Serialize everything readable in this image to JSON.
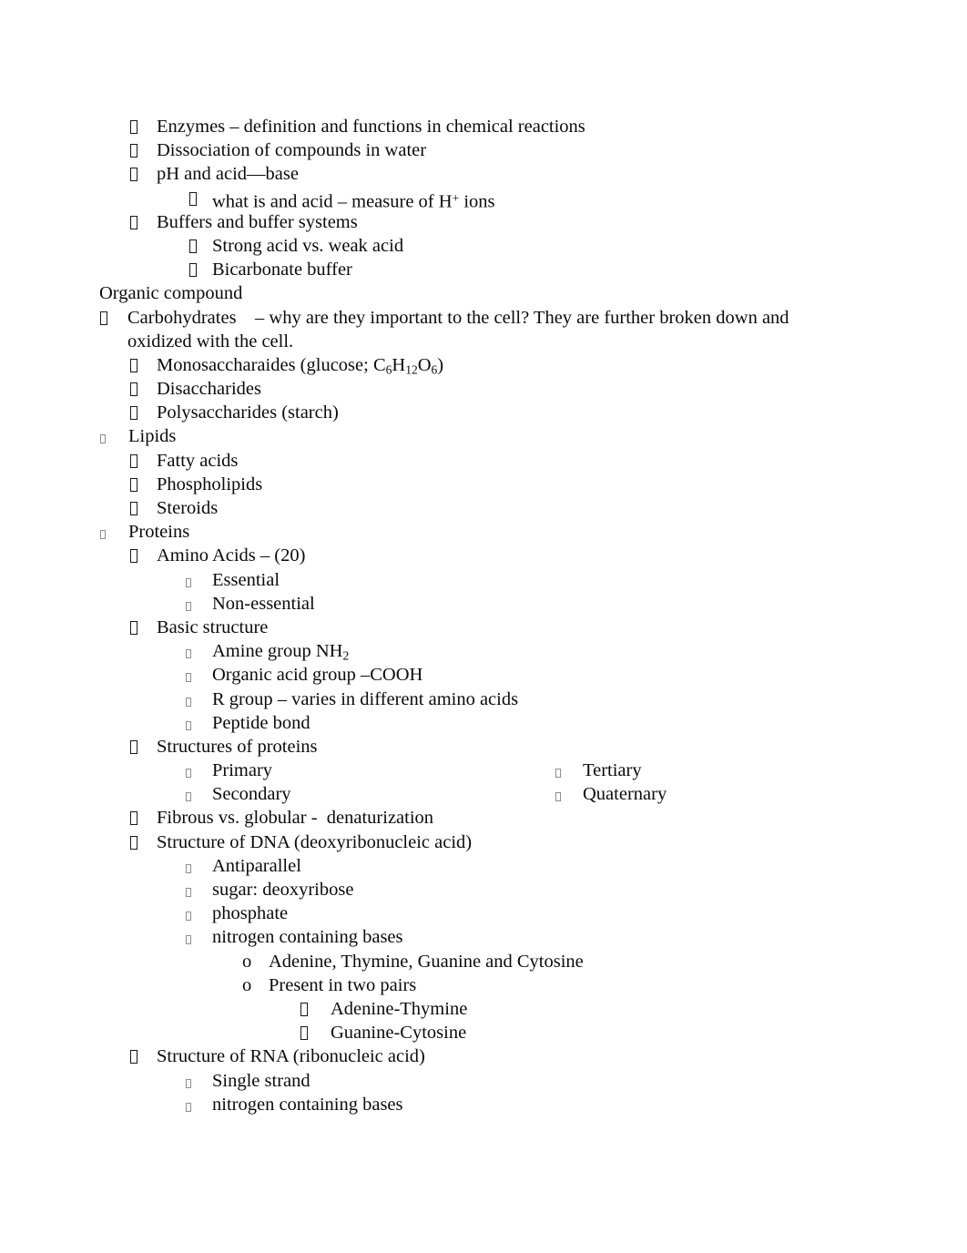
{
  "document": {
    "title": "Organic Compounds Study Outline",
    "background_color": "#ffffff",
    "text_color": "#0b0b0b",
    "bullet_glyph": "missing-glyph-box"
  },
  "outline": {
    "section_heading": "Organic compound",
    "items": [
      {
        "id": "enzymes",
        "level": 1,
        "text": "Enzymes – definition and functions in chemical reactions"
      },
      {
        "id": "dissociation",
        "level": 1,
        "text": "Dissociation of compounds in water"
      },
      {
        "id": "ph-acid-base",
        "level": 1,
        "text": "pH and acid—base"
      },
      {
        "id": "what-is-acid",
        "level": 2,
        "text_pre": "what is and acid – measure of H",
        "sup": "+",
        "text_post": " ions"
      },
      {
        "id": "buffers",
        "level": 1,
        "text": "Buffers and buffer systems"
      },
      {
        "id": "strong-weak-acid",
        "level": 2,
        "text": "Strong acid vs. weak acid"
      },
      {
        "id": "bicarbonate-buffer",
        "level": 2,
        "text": "Bicarbonate buffer"
      },
      {
        "id": "carbohydrates",
        "level": 1,
        "text": "Carbohydrates    – why are they important to the cell? They are further broken down and oxidized with the cell."
      },
      {
        "id": "monosaccharaides",
        "level": 2,
        "text_pre": "Monosaccharaides (glucose; C",
        "sub1": "6",
        "mid1": "H",
        "sub2": "12",
        "mid2": "O",
        "sub3": "6",
        "text_post": ")"
      },
      {
        "id": "disaccharides",
        "level": 2,
        "text": "Disaccharides"
      },
      {
        "id": "polysaccharides",
        "level": 2,
        "text": "Polysaccharides (starch)"
      },
      {
        "id": "lipids",
        "level": 1,
        "text": "Lipids"
      },
      {
        "id": "fatty-acids",
        "level": 2,
        "text": "Fatty acids"
      },
      {
        "id": "phospholipids",
        "level": 2,
        "text": "Phospholipids"
      },
      {
        "id": "steroids",
        "level": 2,
        "text": "Steroids"
      },
      {
        "id": "proteins",
        "level": 1,
        "text": "Proteins"
      },
      {
        "id": "amino-acids",
        "level": 2,
        "text": "Amino Acids – (20)"
      },
      {
        "id": "essential",
        "level": 3,
        "text": "Essential"
      },
      {
        "id": "non-essential",
        "level": 3,
        "text": "Non-essential"
      },
      {
        "id": "basic-structure",
        "level": 2,
        "text": "Basic structure"
      },
      {
        "id": "amine-group",
        "level": 3,
        "text_pre": "Amine group NH",
        "sub": "2"
      },
      {
        "id": "organic-acid-group",
        "level": 3,
        "text": "Organic acid group –COOH"
      },
      {
        "id": "r-group",
        "level": 3,
        "text": "R group – varies in different amino acids"
      },
      {
        "id": "peptide-bond",
        "level": 3,
        "text": "Peptide bond"
      },
      {
        "id": "structures-of-proteins",
        "level": 2,
        "text": "Structures of proteins"
      },
      {
        "id": "primary",
        "level": 3,
        "text": "Primary"
      },
      {
        "id": "tertiary",
        "level": 3,
        "column": "right",
        "text": "Tertiary"
      },
      {
        "id": "secondary",
        "level": 3,
        "text": "Secondary"
      },
      {
        "id": "quaternary",
        "level": 3,
        "column": "right",
        "text": "Quaternary"
      },
      {
        "id": "fibrous-globular",
        "level": 2,
        "text": "Fibrous vs. globular -  denaturization"
      },
      {
        "id": "structure-dna",
        "level": 2,
        "text": "Structure of DNA (deoxyribonucleic acid)"
      },
      {
        "id": "antiparallel",
        "level": 3,
        "text": "Antiparallel"
      },
      {
        "id": "sugar-deoxyribose",
        "level": 3,
        "text": "sugar: deoxyribose"
      },
      {
        "id": "phosphate",
        "level": 3,
        "text": "phosphate"
      },
      {
        "id": "nitrogen-bases-dna",
        "level": 3,
        "text": "nitrogen containing bases"
      },
      {
        "id": "adenine-thymine-guanine-cytosine",
        "level": 4,
        "marker": "o",
        "text": "Adenine, Thymine, Guanine and Cytosine"
      },
      {
        "id": "present-in-two-pairs",
        "level": 4,
        "marker": "o",
        "text": "Present in two pairs"
      },
      {
        "id": "adenine-thymine-pair",
        "level": 5,
        "text": "Adenine-Thymine"
      },
      {
        "id": "guanine-cytosine-pair",
        "level": 5,
        "text": "Guanine-Cytosine"
      },
      {
        "id": "structure-rna",
        "level": 2,
        "text": "Structure of RNA (ribonucleic acid)"
      },
      {
        "id": "single-strand",
        "level": 3,
        "text": "Single strand"
      },
      {
        "id": "nitrogen-bases-rna",
        "level": 3,
        "text": "nitrogen containing bases"
      }
    ]
  },
  "lines": {
    "l1": "Enzymes – definition and functions in chemical reactions",
    "l2": "Dissociation of compounds in water",
    "l3": "pH and acid—base",
    "l4a": "what is and acid – measure of H",
    "l4b": "+",
    "l4c": " ions",
    "l5": "Buffers and buffer systems",
    "l6": "Strong acid vs. weak acid",
    "l7": "Bicarbonate buffer",
    "l8": "Organic compound",
    "l9a": "Carbohydrates    – why are they important to the cell? They are further broken down and",
    "l9b": "oxidized with the cell.",
    "l10a": "Monosaccharaides (glucose; C",
    "l10b": "6",
    "l10c": "H",
    "l10d": "12",
    "l10e": "O",
    "l10f": "6",
    "l10g": ")",
    "l11": "Disaccharides",
    "l12": "Polysaccharides (starch)",
    "l13": "Lipids",
    "l14": "Fatty acids",
    "l15": "Phospholipids",
    "l16": "Steroids",
    "l17": "Proteins",
    "l18": "Amino Acids – (20)",
    "l19": "Essential",
    "l20": "Non-essential",
    "l21": "Basic structure",
    "l22a": "Amine group NH",
    "l22b": "2",
    "l23": "Organic acid group –COOH",
    "l24": "R group – varies in different amino acids",
    "l25": "Peptide bond",
    "l26": "Structures of proteins",
    "l27": "Primary",
    "l28": "Tertiary",
    "l29": "Secondary",
    "l30": "Quaternary",
    "l31": "Fibrous vs. globular -  denaturization",
    "l32": "Structure of DNA (deoxyribonucleic acid)",
    "l33": "Antiparallel",
    "l34": "sugar: deoxyribose",
    "l35": "phosphate",
    "l36": "nitrogen containing bases",
    "l37m": "o",
    "l37": "Adenine, Thymine, Guanine and Cytosine",
    "l38m": "o",
    "l38": "Present in two pairs",
    "l39": "Adenine-Thymine",
    "l40": "Guanine-Cytosine",
    "l41": "Structure of RNA (ribonucleic acid)",
    "l42": "Single strand",
    "l43": "nitrogen containing bases"
  }
}
